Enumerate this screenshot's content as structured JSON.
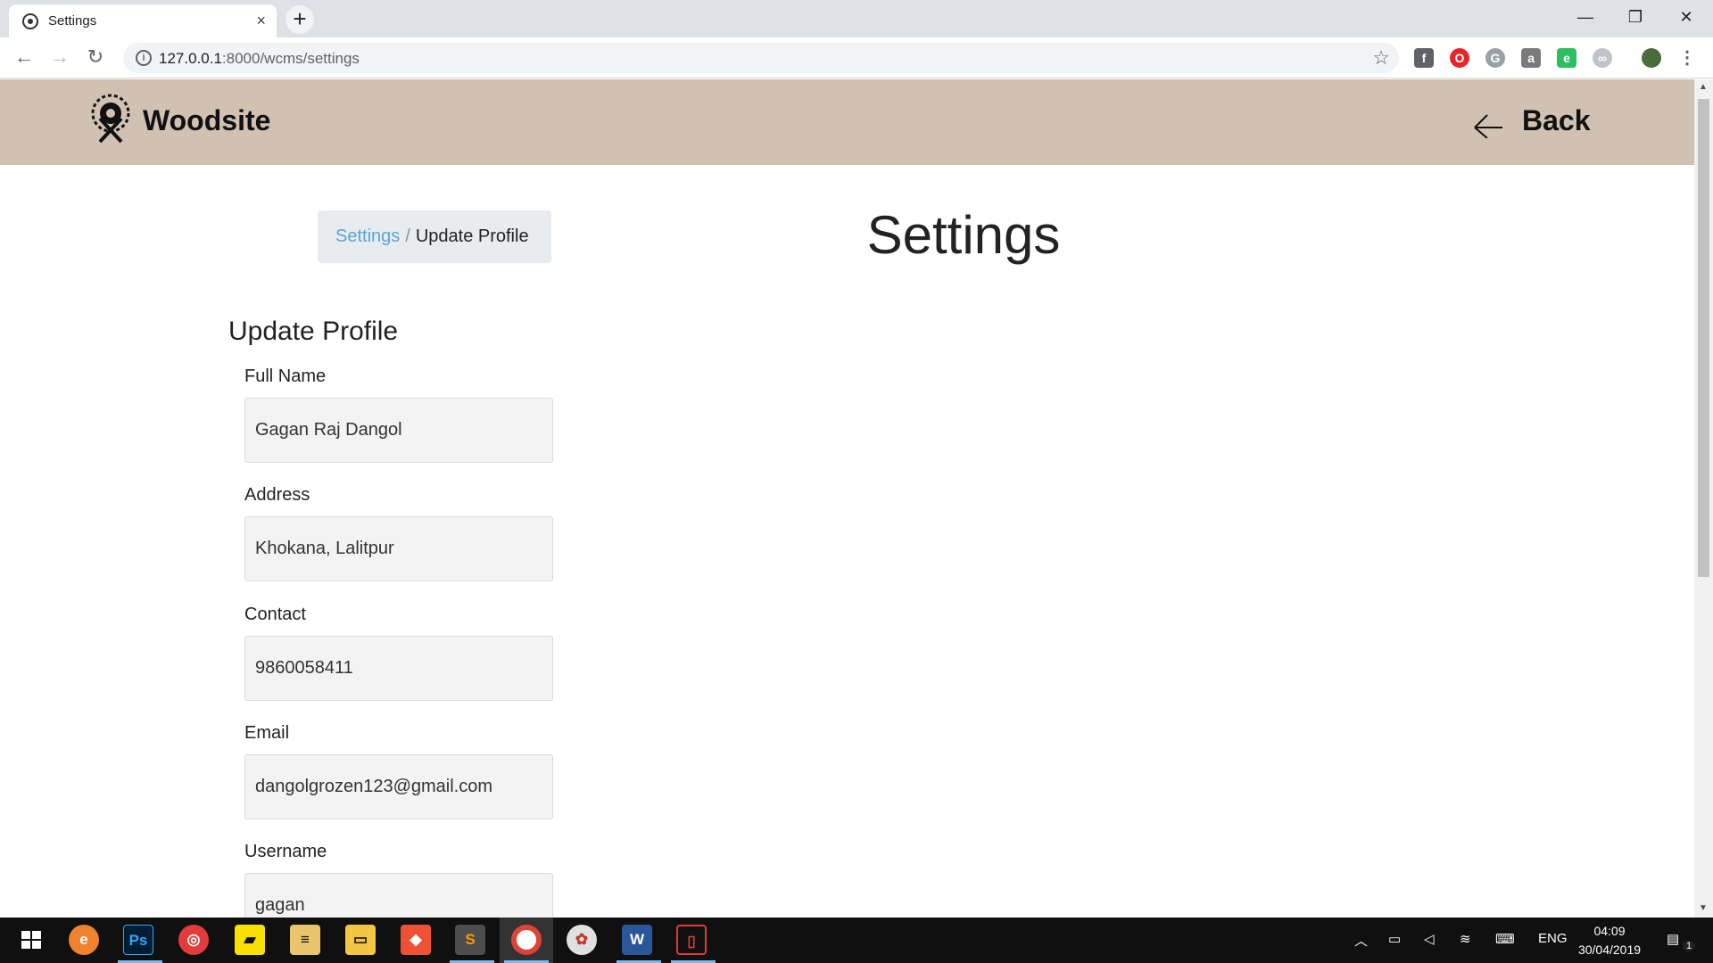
{
  "browser": {
    "tab_title": "Settings",
    "tab_close": "×",
    "new_tab": "+",
    "url_host": "127.0.0.1",
    "url_rest": ":8000/wcms/settings",
    "url_info": "i",
    "star": "☆"
  },
  "window_controls": {
    "minimize": "—",
    "maximize": "❐",
    "close": "✕"
  },
  "nav": {
    "back": "←",
    "forward": "→",
    "reload": "↻"
  },
  "extensions": [
    "facebook-icon",
    "opera-icon",
    "grammarly-icon",
    "lock-icon",
    "evernote-icon",
    "vpn-icon",
    "avatar"
  ],
  "header": {
    "brand_name": "Woodsite",
    "back_label": "Back"
  },
  "breadcrumb": {
    "link": "Settings",
    "separator": "/",
    "current": "Update Profile"
  },
  "page_title": "Settings",
  "form": {
    "section_title": "Update Profile",
    "fields": [
      {
        "label": "Full Name",
        "value": "Gagan Raj Dangol"
      },
      {
        "label": "Address",
        "value": "Khokana, Lalitpur"
      },
      {
        "label": "Contact",
        "value": "9860058411"
      },
      {
        "label": "Email",
        "value": "dangolgrozen123@gmail.com"
      },
      {
        "label": "Username",
        "value": "gagan"
      }
    ]
  },
  "taskbar": {
    "apps": [
      "windows-start-icon",
      "edge-icon",
      "photoshop-icon",
      "app-icon",
      "sticky-notes-icon",
      "notepad-icon",
      "file-explorer-icon",
      "git-icon",
      "sublime-text-icon",
      "chrome-icon",
      "paint-icon",
      "word-icon",
      "screen-recorder-icon"
    ],
    "photoshop_label": "Ps",
    "word_label": "W",
    "sublime_label": "S",
    "lang": "ENG",
    "time": "04:09",
    "date": "30/04/2019",
    "notifications": "1"
  }
}
